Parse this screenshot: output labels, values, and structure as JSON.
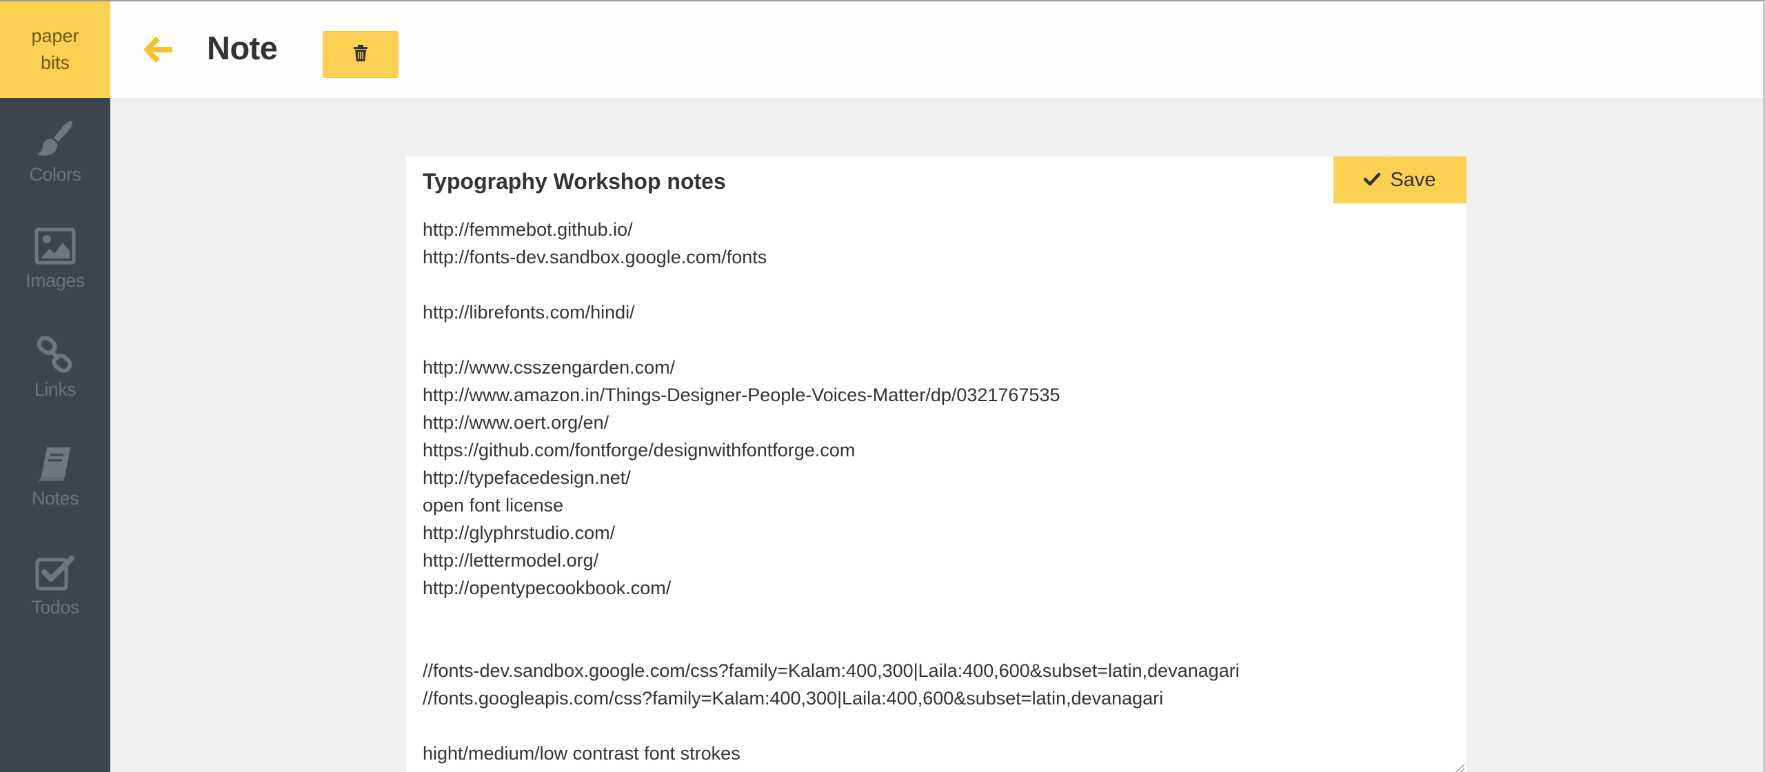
{
  "app": {
    "logo_line1": "paper",
    "logo_line2": "bits",
    "accent_color": "#fcd050",
    "sidebar_color": "#3e444c"
  },
  "sidebar": {
    "items": [
      {
        "label": "Colors",
        "icon": "paintbrush-icon"
      },
      {
        "label": "Images",
        "icon": "image-icon"
      },
      {
        "label": "Links",
        "icon": "link-icon"
      },
      {
        "label": "Notes",
        "icon": "book-icon"
      },
      {
        "label": "Todos",
        "icon": "checkbox-icon"
      }
    ]
  },
  "header": {
    "title": "Note",
    "back_icon": "arrow-left-icon",
    "delete_icon": "trash-icon"
  },
  "editor": {
    "note_title": "Typography Workshop notes",
    "save_label": "Save",
    "save_icon": "checkmark-icon",
    "body": "http://femmebot.github.io/\nhttp://fonts-dev.sandbox.google.com/fonts\n\nhttp://librefonts.com/hindi/\n\nhttp://www.csszengarden.com/\nhttp://www.amazon.in/Things-Designer-People-Voices-Matter/dp/0321767535\nhttp://www.oert.org/en/\nhttps://github.com/fontforge/designwithfontforge.com\nhttp://typefacedesign.net/\nopen font license\nhttp://glyphrstudio.com/\nhttp://lettermodel.org/\nhttp://opentypecookbook.com/\n\n\n//fonts-dev.sandbox.google.com/css?family=Kalam:400,300|Laila:400,600&subset=latin,devanagari\n//fonts.googleapis.com/css?family=Kalam:400,300|Laila:400,600&subset=latin,devanagari\n\nhight/medium/low contrast font strokes"
  }
}
